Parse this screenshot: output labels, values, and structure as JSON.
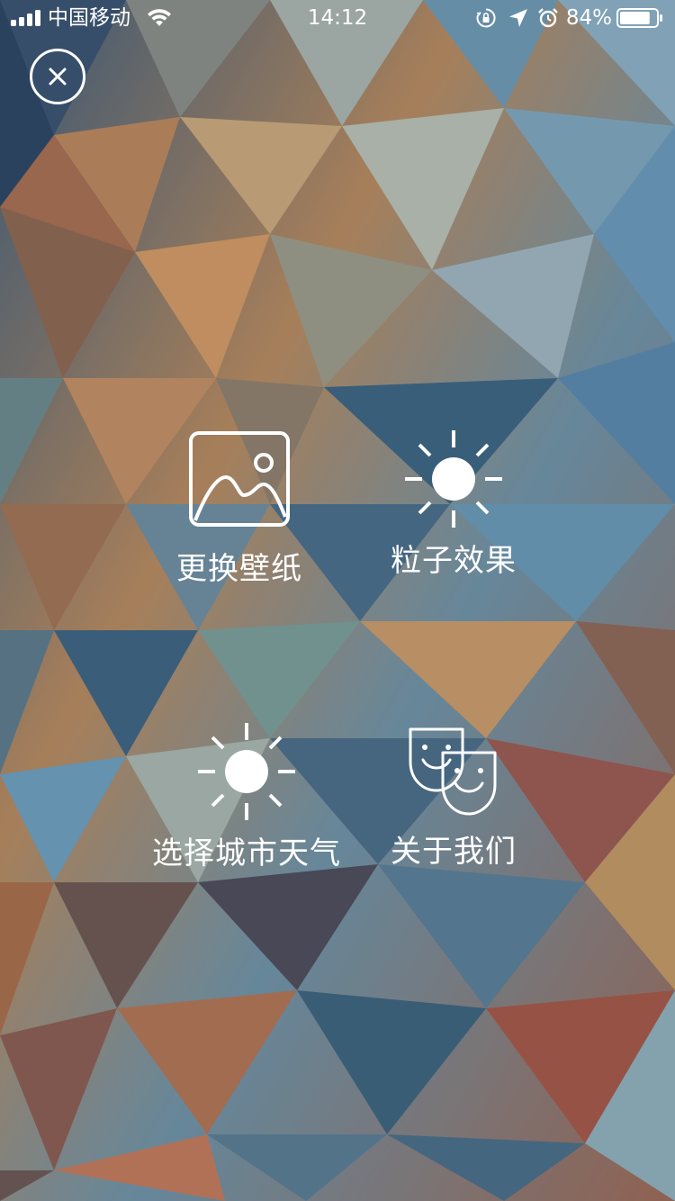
{
  "status_bar": {
    "carrier": "中国移动",
    "time": "14:12",
    "battery_percent": "84%",
    "battery_level": 0.84,
    "icons": [
      "signal-icon",
      "wifi-icon",
      "rotation-lock-icon",
      "location-arrow-icon",
      "alarm-clock-icon",
      "battery-icon"
    ]
  },
  "close_button": {
    "icon": "close-icon"
  },
  "menu": {
    "items": [
      {
        "label": "更换壁纸",
        "icon": "image-icon"
      },
      {
        "label": "粒子效果",
        "icon": "sun-icon"
      },
      {
        "label": "选择城市天气",
        "icon": "sun-icon"
      },
      {
        "label": "关于我们",
        "icon": "theater-masks-icon"
      }
    ]
  },
  "colors": {
    "text": "#ffffff",
    "icon_fill": "#ffffff"
  }
}
